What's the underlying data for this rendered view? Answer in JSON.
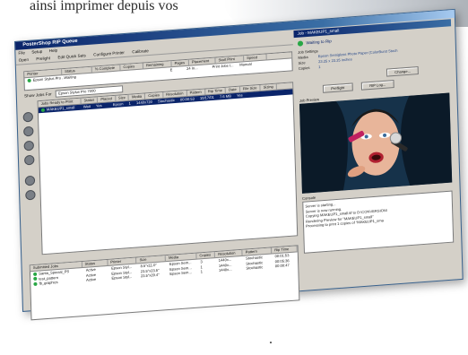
{
  "captions": {
    "top": "ainsi imprimer depuis vos",
    "bottom": "."
  },
  "window": {
    "title": "PosterShop RIP Queue",
    "menu": [
      "File",
      "Setup",
      "Help"
    ],
    "toolbar": [
      "Open",
      "Prelight",
      "Edit Quick Sets",
      "Configure Printer",
      "Calibrate"
    ]
  },
  "printers": {
    "columns": [
      "Printer",
      "Status",
      "% Complete",
      "Copies",
      "Remaining",
      "Pages",
      "Placement",
      "Start Print",
      "Speed"
    ],
    "rows": [
      {
        "printer": "Epson Stylus Pro ...",
        "status": "Waiting",
        "complete": "",
        "copies": "",
        "remaining": "",
        "pages": "E",
        "placement": "24 In...",
        "start": "Print Jobs I...",
        "speed": "Manual"
      }
    ]
  },
  "jobs_for": {
    "label": "Show Jobs For",
    "value": "Epson Stylus Pro 7000"
  },
  "jobs": {
    "columns": [
      "Jobs Ready to Print",
      "Status",
      "Placed",
      "Size",
      "Media",
      "Copies",
      "Resolution",
      "Pattern",
      "Rip Time",
      "Date",
      "File Size",
      "Sizing"
    ],
    "rows": [
      {
        "name": "MAKEUP1_small",
        "status": "Wait",
        "placed": "Yes",
        "size": "",
        "media": "Epson",
        "copies": "1",
        "resolution": "1440x720",
        "pattern": "Stochastic",
        "rip_time": "00:00:53",
        "date": "10/17/01",
        "file_size": "7.6 MB",
        "sizing": "Yes"
      }
    ]
  },
  "submitted": {
    "columns": [
      "Submitted Jobs",
      "Status",
      "Printer",
      "Size",
      "Media",
      "Copies",
      "Resolution",
      "Pattern",
      "Rip Time"
    ],
    "rows": [
      {
        "name": "Santa_Special_PS",
        "status": "Active",
        "printer": "Epson Styl...",
        "size": "8.5\"x11.0\"",
        "media": "Epson Sem...",
        "copies": "3",
        "resolution": "1440x...",
        "pattern": "Stochastic",
        "rip_time": "00:01:53"
      },
      {
        "name": "test_pattern",
        "status": "Active",
        "printer": "Epson Styl...",
        "size": "23.5\"x23.5\"",
        "media": "Epson Sem...",
        "copies": "1",
        "resolution": "1440x...",
        "pattern": "Stochastic",
        "rip_time": "00:05:36"
      },
      {
        "name": "fb_graphics",
        "status": "Active",
        "printer": "Epson Styl...",
        "size": "23.5\"x29.4\"",
        "media": "Epson Sem...",
        "copies": "1",
        "resolution": "1440x...",
        "pattern": "Stochastic",
        "rip_time": "00:00:47"
      }
    ]
  },
  "job_panel": {
    "title": "Job - MAKEUP1_small",
    "status": "Waiting to Rip",
    "settings_label": "Job Settings",
    "settings": [
      {
        "key": "Media",
        "value": "Epson Semigloss Photo Paper (ColorBurst Stoch"
      },
      {
        "key": "Size",
        "value": "23.25 x 23.25 inches"
      },
      {
        "key": "Copies",
        "value": "1"
      }
    ],
    "change_button": "Change...",
    "preflight_button": "Preflight",
    "riplog_button": "RIP Log...",
    "preview_label": "Job Preview"
  },
  "console": {
    "label": "Console",
    "lines": [
      "Server is starting...",
      "Server is now running.",
      "Copying MAKEUP1_small.tif to D:\\CONVERSION\\",
      "Rendering Preview for \"MAKEUP1_small\"",
      "Processing to print 1 copies of \"MAKEUP1_sma"
    ]
  },
  "colors": {
    "titlebar": "#0a246a",
    "status_ok": "#28a745",
    "window_bg": "#d4d0c8"
  }
}
